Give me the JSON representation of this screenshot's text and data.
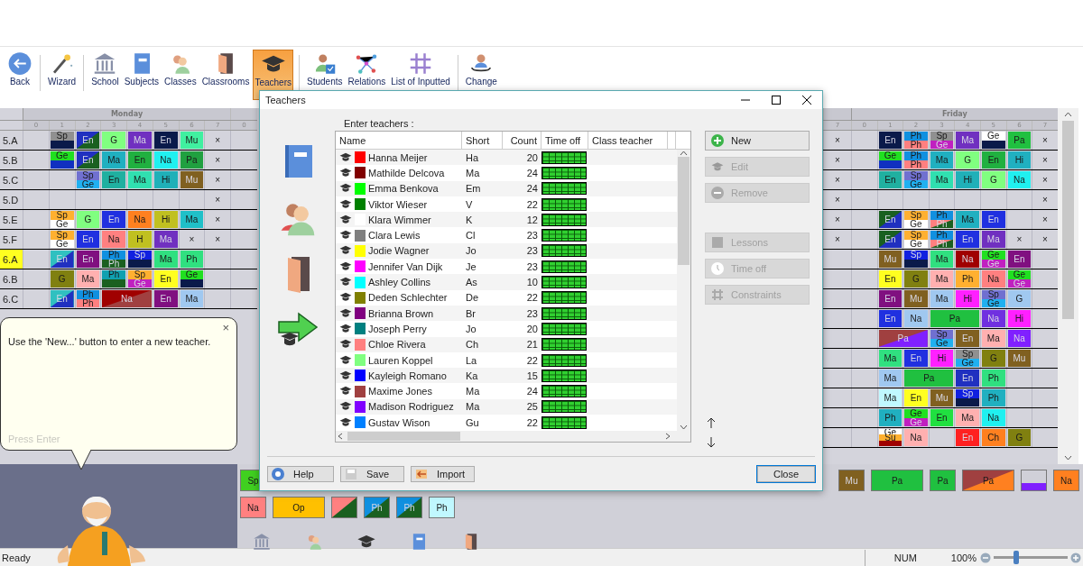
{
  "toolbar": [
    {
      "label": "Back",
      "selected": false,
      "divider_after": true
    },
    {
      "label": "Wizard",
      "selected": false,
      "divider_after": true
    },
    {
      "label": "School",
      "selected": false,
      "divider_after": false
    },
    {
      "label": "Subjects",
      "selected": false,
      "divider_after": false
    },
    {
      "label": "Classes",
      "selected": false,
      "divider_after": false
    },
    {
      "label": "Classrooms",
      "selected": false,
      "divider_after": false
    },
    {
      "label": "Teachers",
      "selected": true,
      "divider_after": true
    },
    {
      "label": "Students",
      "selected": false,
      "divider_after": false
    },
    {
      "label": "Relations",
      "selected": false,
      "divider_after": false
    },
    {
      "label": "List of Inputted",
      "selected": false,
      "divider_after": true
    },
    {
      "label": "Change",
      "selected": false,
      "divider_after": false
    }
  ],
  "timetable_left": {
    "day": "Monday",
    "periods": [
      "0",
      "1",
      "2",
      "3",
      "4",
      "5",
      "6",
      "7"
    ],
    "next_day_periods": [
      "0"
    ],
    "rows": [
      {
        "label": "5.A",
        "highlighted": false,
        "cells": [
          {},
          {
            "parts": [
              {
                "text": "Sp",
                "color": "#909090"
              },
              {
                "color": "#0a1a4a"
              }
            ]
          },
          {
            "parts": [
              {
                "text": "En",
                "color": "#2030c0",
                "corner": {
                  "color": "#1a6020"
                }
              }
            ]
          },
          {
            "parts": [
              {
                "text": "G",
                "color": "#80ff80"
              }
            ]
          },
          {
            "parts": [
              {
                "text": "Ma",
                "color": "#7030c0"
              }
            ]
          },
          {
            "parts": [
              {
                "text": "En",
                "color": "#0a1a4a"
              }
            ]
          },
          {
            "parts": [
              {
                "text": "Mu",
                "color": "#40f0a0"
              }
            ]
          },
          {
            "parts": [
              {
                "text": "×"
              }
            ]
          }
        ]
      },
      {
        "label": "5.B",
        "highlighted": false,
        "cells": [
          {},
          {
            "parts": [
              {
                "text": "Ge",
                "color": "#20e020"
              },
              {
                "color": "#1030c0"
              }
            ]
          },
          {
            "parts": [
              {
                "text": "En",
                "color": "#2030c0",
                "corner": {
                  "color": "#1a6020"
                }
              }
            ]
          },
          {
            "parts": [
              {
                "text": "Ma",
                "color": "#20b0c0"
              }
            ]
          },
          {
            "parts": [
              {
                "text": "En",
                "color": "#20b040"
              }
            ]
          },
          {
            "parts": [
              {
                "text": "Na",
                "color": "#20f0f0"
              }
            ]
          },
          {
            "parts": [
              {
                "text": "Pa",
                "color": "#20a040"
              }
            ]
          },
          {
            "parts": [
              {
                "text": "×"
              }
            ]
          }
        ]
      },
      {
        "label": "5.C",
        "highlighted": false,
        "cells": [
          {},
          {},
          {
            "parts": [
              {
                "text": "Sp",
                "color": "#7070d0"
              },
              {
                "text": "Ge",
                "color": "#20b0f0"
              }
            ]
          },
          {
            "parts": [
              {
                "text": "En",
                "color": "#20b0a0"
              }
            ]
          },
          {
            "parts": [
              {
                "text": "Ma",
                "color": "#30e0b0"
              }
            ]
          },
          {
            "parts": [
              {
                "text": "Hi",
                "color": "#20b0b8"
              }
            ]
          },
          {
            "parts": [
              {
                "text": "Mu",
                "color": "#806020"
              }
            ]
          },
          {
            "parts": [
              {
                "text": "×"
              }
            ]
          }
        ]
      },
      {
        "label": "5.D",
        "highlighted": false,
        "cells": [
          {},
          {},
          {},
          {},
          {},
          {},
          {},
          {
            "parts": [
              {
                "text": "×"
              }
            ]
          }
        ]
      },
      {
        "label": "5.E",
        "highlighted": false,
        "cells": [
          {},
          {
            "parts": [
              {
                "text": "Sp",
                "color": "#ffb030"
              },
              {
                "text": "Ge",
                "color": "#ffffff"
              }
            ]
          },
          {
            "parts": [
              {
                "text": "G",
                "color": "#80ff80"
              }
            ]
          },
          {
            "parts": [
              {
                "text": "En",
                "color": "#2030e0"
              }
            ]
          },
          {
            "parts": [
              {
                "text": "Na",
                "color": "#ff8020"
              }
            ]
          },
          {
            "parts": [
              {
                "text": "Hi",
                "color": "#c0c020"
              }
            ]
          },
          {
            "parts": [
              {
                "text": "Ma",
                "color": "#20c0c8"
              }
            ]
          },
          {
            "parts": [
              {
                "text": "×"
              }
            ]
          }
        ]
      },
      {
        "label": "5.F",
        "highlighted": false,
        "cells": [
          {},
          {
            "parts": [
              {
                "text": "Sp",
                "color": "#ffb030"
              },
              {
                "text": "Ge",
                "color": "#ffffff"
              }
            ]
          },
          {
            "parts": [
              {
                "text": "En",
                "color": "#2030e0"
              }
            ]
          },
          {
            "parts": [
              {
                "text": "Na",
                "color": "#ff8080"
              }
            ]
          },
          {
            "parts": [
              {
                "text": "H",
                "color": "#c0c020"
              }
            ]
          },
          {
            "parts": [
              {
                "text": "Ma",
                "color": "#7030c0"
              }
            ]
          },
          {
            "parts": [
              {
                "text": "×"
              }
            ]
          },
          {
            "parts": [
              {
                "text": "×"
              }
            ]
          }
        ]
      },
      {
        "label": "6.A",
        "highlighted": true,
        "cells": [
          {},
          {
            "parts": [
              {
                "text": "En",
                "color": "#30c0c0",
                "corner": {
                  "color": "#2030c0"
                }
              }
            ]
          },
          {
            "parts": [
              {
                "text": "En",
                "color": "#801080"
              }
            ]
          },
          {
            "parts": [
              {
                "text": "Ph",
                "color": "#1090e0"
              },
              {
                "text": "Ph",
                "color": "#1a6020"
              }
            ]
          },
          {
            "parts": [
              {
                "text": "Sp",
                "color": "#1020e0"
              },
              {
                "color": "#0a1a4a"
              }
            ]
          },
          {
            "parts": [
              {
                "text": "Ma",
                "color": "#30e080"
              }
            ]
          },
          {
            "parts": [
              {
                "text": "Ph",
                "color": "#30e080"
              }
            ]
          },
          {}
        ]
      },
      {
        "label": "6.B",
        "highlighted": false,
        "cells": [
          {},
          {
            "parts": [
              {
                "text": "G",
                "color": "#808010"
              }
            ]
          },
          {
            "parts": [
              {
                "text": "Ma",
                "color": "#ffb0b0"
              }
            ]
          },
          {
            "parts": [
              {
                "text": "Ph",
                "color": "#10a0b0"
              },
              {
                "color": "#1a6020"
              }
            ]
          },
          {
            "parts": [
              {
                "text": "Sp",
                "color": "#ffb030"
              },
              {
                "text": "Ge",
                "color": "#c020c0"
              }
            ]
          },
          {
            "parts": [
              {
                "text": "En",
                "color": "#ffff20"
              }
            ]
          },
          {
            "parts": [
              {
                "text": "Ge",
                "color": "#20e020"
              },
              {
                "color": "#0a1a4a"
              }
            ]
          },
          {}
        ]
      },
      {
        "label": "6.C",
        "highlighted": false,
        "cells": [
          {},
          {
            "parts": [
              {
                "text": "En",
                "color": "#30c0c0",
                "corner": {
                  "color": "#2030c0"
                }
              }
            ]
          },
          {
            "parts": [
              {
                "text": "Ph",
                "color": "#1090e0"
              },
              {
                "text": "Ph",
                "color": "#ff8080"
              }
            ]
          },
          {
            "parts": [
              {
                "text": "Na",
                "color": "#a00000",
                "corner": {
                  "color": "#a04040"
                }
              }
            ]
          },
          {
            "merged": true
          },
          {
            "parts": [
              {
                "text": "En",
                "color": "#801080"
              }
            ]
          },
          {
            "parts": [
              {
                "text": "Ma",
                "color": "#a0c8f0"
              }
            ]
          },
          {}
        ]
      }
    ]
  },
  "timetable_right": {
    "day": "Friday",
    "prev_periods": [
      "7"
    ],
    "periods": [
      "0",
      "1",
      "2",
      "3",
      "4",
      "5",
      "6",
      "7"
    ],
    "rows": [
      {
        "prev": {
          "parts": [
            {
              "text": "×"
            }
          ]
        },
        "cells": [
          {},
          {
            "parts": [
              {
                "text": "En",
                "color": "#0a1a4a"
              }
            ]
          },
          {
            "parts": [
              {
                "text": "Ph",
                "color": "#1090e0"
              },
              {
                "text": "Ph",
                "color": "#ff8080"
              }
            ]
          },
          {
            "parts": [
              {
                "text": "Sp",
                "color": "#909090"
              },
              {
                "text": "Ge",
                "color": "#c020c0"
              }
            ]
          },
          {
            "parts": [
              {
                "text": "Ma",
                "color": "#7030c0"
              }
            ]
          },
          {
            "parts": [
              {
                "text": "Ge",
                "color": "#ffffff"
              },
              {
                "color": "#0a1a4a"
              }
            ]
          },
          {
            "parts": [
              {
                "text": "Pa",
                "color": "#20c040"
              }
            ]
          },
          {
            "parts": [
              {
                "text": "×"
              }
            ]
          }
        ]
      },
      {
        "prev": {
          "parts": [
            {
              "text": "×"
            }
          ]
        },
        "cells": [
          {},
          {
            "parts": [
              {
                "text": "Ge",
                "color": "#20e020"
              },
              {
                "color": "#1030c0"
              }
            ]
          },
          {
            "parts": [
              {
                "text": "Ph",
                "color": "#1090e0"
              },
              {
                "text": "Ph",
                "color": "#ff8080"
              }
            ]
          },
          {
            "parts": [
              {
                "text": "Ma",
                "color": "#20b0c0"
              }
            ]
          },
          {
            "parts": [
              {
                "text": "G",
                "color": "#80ff80"
              }
            ]
          },
          {
            "parts": [
              {
                "text": "En",
                "color": "#20b040"
              }
            ]
          },
          {
            "parts": [
              {
                "text": "Hi",
                "color": "#20b0c0"
              }
            ]
          },
          {
            "parts": [
              {
                "text": "×"
              }
            ]
          }
        ]
      },
      {
        "prev": {
          "parts": [
            {
              "text": "×"
            }
          ]
        },
        "cells": [
          {},
          {
            "parts": [
              {
                "text": "En",
                "color": "#20b0a0"
              }
            ]
          },
          {
            "parts": [
              {
                "text": "Sp",
                "color": "#7070d0"
              },
              {
                "text": "Ge",
                "color": "#20b0f0"
              }
            ]
          },
          {
            "parts": [
              {
                "text": "Ma",
                "color": "#30e0b0"
              }
            ]
          },
          {
            "parts": [
              {
                "text": "Hi",
                "color": "#20b0b8"
              }
            ]
          },
          {
            "parts": [
              {
                "text": "G",
                "color": "#80ff80"
              }
            ]
          },
          {
            "parts": [
              {
                "text": "Na",
                "color": "#20f0f0"
              }
            ]
          },
          {
            "parts": [
              {
                "text": "×"
              }
            ]
          }
        ]
      },
      {
        "prev": {
          "parts": [
            {
              "text": "×"
            }
          ]
        },
        "cells": [
          {},
          {},
          {},
          {},
          {},
          {},
          {},
          {
            "parts": [
              {
                "text": "×"
              }
            ]
          }
        ]
      },
      {
        "prev": {
          "parts": [
            {
              "text": "×"
            }
          ]
        },
        "cells": [
          {},
          {
            "parts": [
              {
                "text": "En",
                "color": "#1a6020",
                "corner": {
                  "color": "#2030c0"
                }
              }
            ]
          },
          {
            "parts": [
              {
                "text": "Sp",
                "color": "#ffb030"
              },
              {
                "text": "Ge",
                "color": "#ffffff"
              }
            ]
          },
          {
            "parts": [
              {
                "text": "Ph",
                "color": "#1090e0"
              },
              {
                "text": "Ph",
                "color": "#ff8080",
                "corner": {
                  "color": "#1a6020"
                }
              }
            ]
          },
          {
            "parts": [
              {
                "text": "Ma",
                "color": "#20b0c0"
              }
            ]
          },
          {
            "parts": [
              {
                "text": "En",
                "color": "#2030e0"
              }
            ]
          },
          {},
          {
            "parts": [
              {
                "text": "×"
              }
            ]
          }
        ]
      },
      {
        "prev": {
          "parts": [
            {
              "text": "×"
            }
          ]
        },
        "cells": [
          {},
          {
            "parts": [
              {
                "text": "En",
                "color": "#1a6020",
                "corner": {
                  "color": "#2030c0"
                }
              }
            ]
          },
          {
            "parts": [
              {
                "text": "Sp",
                "color": "#ffb030"
              },
              {
                "text": "Ge",
                "color": "#ffffff"
              }
            ]
          },
          {
            "parts": [
              {
                "text": "Ph",
                "color": "#1090e0"
              },
              {
                "text": "Ph",
                "color": "#ff8080",
                "corner": {
                  "color": "#1a6020"
                }
              }
            ]
          },
          {
            "parts": [
              {
                "text": "En",
                "color": "#2030e0"
              }
            ]
          },
          {
            "parts": [
              {
                "text": "Ma",
                "color": "#7030c0"
              }
            ]
          },
          {
            "parts": [
              {
                "text": "×"
              }
            ]
          },
          {
            "parts": [
              {
                "text": "×"
              }
            ]
          }
        ]
      },
      {
        "prev": {},
        "cells": [
          {},
          {
            "parts": [
              {
                "text": "Mu",
                "color": "#806020"
              }
            ]
          },
          {
            "parts": [
              {
                "text": "Sp",
                "color": "#1020e0"
              },
              {
                "color": "#0a1a4a"
              }
            ]
          },
          {
            "parts": [
              {
                "text": "Ma",
                "color": "#30e080"
              }
            ]
          },
          {
            "parts": [
              {
                "text": "Na",
                "color": "#a00000"
              }
            ]
          },
          {
            "parts": [
              {
                "text": "Ge",
                "color": "#20e020"
              },
              {
                "text": "Ge",
                "color": "#c020c0"
              }
            ]
          },
          {
            "parts": [
              {
                "text": "En",
                "color": "#801080"
              }
            ]
          },
          {}
        ]
      },
      {
        "prev": {},
        "cells": [
          {},
          {
            "parts": [
              {
                "text": "En",
                "color": "#ffff20"
              }
            ]
          },
          {
            "parts": [
              {
                "text": "G",
                "color": "#808010"
              }
            ]
          },
          {
            "parts": [
              {
                "text": "Ma",
                "color": "#ffb0b0"
              }
            ]
          },
          {
            "parts": [
              {
                "text": "Ph",
                "color": "#ffb030"
              }
            ]
          },
          {
            "parts": [
              {
                "text": "Na",
                "color": "#ff8080"
              }
            ]
          },
          {
            "parts": [
              {
                "text": "Ge",
                "color": "#20e020"
              },
              {
                "text": "Ge",
                "color": "#c020c0"
              }
            ]
          },
          {}
        ]
      },
      {
        "prev": {},
        "cells": [
          {},
          {
            "parts": [
              {
                "text": "En",
                "color": "#801080"
              }
            ]
          },
          {
            "parts": [
              {
                "text": "Mu",
                "color": "#806020"
              }
            ]
          },
          {
            "parts": [
              {
                "text": "Ma",
                "color": "#a0c8f0"
              }
            ]
          },
          {
            "parts": [
              {
                "text": "Hi",
                "color": "#ff20ff"
              }
            ]
          },
          {
            "parts": [
              {
                "text": "Sp",
                "color": "#7070d0"
              },
              {
                "text": "Ge",
                "color": "#20b0f0"
              }
            ]
          },
          {
            "parts": [
              {
                "text": "G",
                "color": "#a0c8f0"
              }
            ]
          },
          {}
        ]
      },
      {
        "prev": {},
        "cells": [
          {},
          {
            "parts": [
              {
                "text": "En",
                "color": "#2030e0"
              }
            ]
          },
          {
            "parts": [
              {
                "text": "Na",
                "color": "#a0c8f0"
              }
            ]
          },
          {
            "parts": [
              {
                "text": "Pa",
                "color": "#20c040"
              }
            ]
          },
          {
            "merged": true
          },
          {
            "parts": [
              {
                "text": "Na",
                "color": "#7030e0"
              }
            ]
          },
          {
            "parts": [
              {
                "text": "Hi",
                "color": "#ff20ff"
              }
            ]
          },
          {}
        ]
      },
      {
        "prev": {},
        "cells": [
          {},
          {
            "parts": [
              {
                "text": "Pa",
                "color": "#a04040",
                "corner": {
                  "color": "#8020ff"
                }
              }
            ]
          },
          {
            "merged": true
          },
          {
            "parts": [
              {
                "text": "Sp",
                "color": "#7070d0"
              },
              {
                "text": "Ge",
                "color": "#20b0f0"
              }
            ]
          },
          {
            "parts": [
              {
                "text": "En",
                "color": "#806020"
              }
            ]
          },
          {
            "parts": [
              {
                "text": "Ma",
                "color": "#ffb0b0"
              }
            ]
          },
          {
            "parts": [
              {
                "text": "Na",
                "color": "#8020ff"
              }
            ]
          },
          {}
        ]
      },
      {
        "prev": {},
        "cells": [
          {},
          {
            "parts": [
              {
                "text": "Ma",
                "color": "#30e080"
              }
            ]
          },
          {
            "parts": [
              {
                "text": "En",
                "color": "#2030e0"
              }
            ]
          },
          {
            "parts": [
              {
                "text": "Hi",
                "color": "#ff20ff"
              }
            ]
          },
          {
            "parts": [
              {
                "text": "Sp",
                "color": "#909090"
              },
              {
                "text": "Ge",
                "color": "#20b0f0"
              }
            ]
          },
          {
            "parts": [
              {
                "text": "G",
                "color": "#808010"
              }
            ]
          },
          {
            "parts": [
              {
                "text": "Mu",
                "color": "#806020"
              }
            ]
          },
          {}
        ]
      },
      {
        "prev": {},
        "cells": [
          {},
          {
            "parts": [
              {
                "text": "Ma",
                "color": "#a0c8f0"
              }
            ]
          },
          {
            "parts": [
              {
                "text": "Pa",
                "color": "#20c040"
              }
            ]
          },
          {
            "merged": true
          },
          {
            "parts": [
              {
                "text": "En",
                "color": "#2030c0"
              }
            ]
          },
          {
            "parts": [
              {
                "text": "Ph",
                "color": "#30e080"
              }
            ]
          },
          {},
          {}
        ]
      },
      {
        "prev": {},
        "cells": [
          {},
          {
            "parts": [
              {
                "text": "Ma",
                "color": "#c0f8ff"
              }
            ]
          },
          {
            "parts": [
              {
                "text": "En",
                "color": "#ffff20"
              }
            ]
          },
          {
            "parts": [
              {
                "text": "Mu",
                "color": "#806020"
              }
            ]
          },
          {
            "parts": [
              {
                "text": "Sp",
                "color": "#1020e0"
              },
              {
                "color": "#0a1a4a"
              }
            ]
          },
          {
            "parts": [
              {
                "text": "Ph",
                "color": "#20b0c0"
              }
            ]
          },
          {},
          {}
        ]
      },
      {
        "prev": {},
        "cells": [
          {},
          {
            "parts": [
              {
                "text": "Ph",
                "color": "#20b0c0"
              }
            ]
          },
          {
            "parts": [
              {
                "text": "Ge",
                "color": "#20e020"
              },
              {
                "text": "Ge",
                "color": "#c020c0"
              }
            ]
          },
          {
            "parts": [
              {
                "text": "En",
                "color": "#20e040"
              }
            ]
          },
          {
            "parts": [
              {
                "text": "Ma",
                "color": "#ffb0b0"
              }
            ]
          },
          {
            "parts": [
              {
                "text": "Na",
                "color": "#20f0f0"
              }
            ]
          },
          {},
          {}
        ]
      },
      {
        "prev": {},
        "cells": [
          {},
          {
            "parts": [
              {
                "text": "Ge",
                "color": "#ffffff"
              },
              {
                "text": "Su",
                "color": "#ffb030"
              },
              {
                "color": "#a00000"
              }
            ]
          },
          {
            "parts": [
              {
                "text": "Na",
                "color": "#ffb0b0"
              }
            ]
          },
          {},
          {
            "parts": [
              {
                "text": "En",
                "color": "#ff2020"
              }
            ]
          },
          {
            "parts": [
              {
                "text": "Ch",
                "color": "#ff8020"
              }
            ]
          },
          {
            "parts": [
              {
                "text": "G",
                "color": "#808010"
              }
            ]
          },
          {}
        ]
      }
    ]
  },
  "tray": {
    "row1_left": [
      {
        "text": "Sp",
        "color": "#40d020"
      }
    ],
    "row1_right": [
      {
        "text": "Mu",
        "color": "#806020"
      },
      {
        "text": "Pa",
        "color": "#20c040",
        "kind": "double"
      },
      {
        "text": "Pa",
        "color": "#20c040"
      },
      {
        "text": "Pa",
        "color": "#a04040",
        "corner": {
          "color": "#ff8020"
        },
        "kind": "double"
      },
      {
        "color": "#d0d0d8",
        "band": {
          "color": "#8020ff"
        }
      },
      {
        "text": "Na",
        "color": "#ff8020"
      }
    ],
    "row2": [
      {
        "text": "Na",
        "color": "#ff8080"
      },
      {
        "text": "Op",
        "color": "#ffc000",
        "kind": "double"
      },
      {
        "color": "#ff8080",
        "corner": {
          "color": "#1a6020"
        }
      },
      {
        "text": "Ph",
        "color": "#1090e0",
        "corner": {
          "color": "#1a6020"
        }
      },
      {
        "text": "Ph",
        "color": "#1090e0",
        "corner": {
          "color": "#1a6020"
        }
      },
      {
        "text": "Ph",
        "color": "#c0f8ff"
      }
    ]
  },
  "dialog": {
    "title": "Teachers",
    "prompt": "Enter teachers :",
    "columns": [
      "Name",
      "Short",
      "Count",
      "Time off",
      "Class teacher"
    ],
    "teachers": [
      {
        "name": "Hanna Meijer",
        "short": "Ha",
        "count": "20",
        "color": "#ff0000"
      },
      {
        "name": "Mathilde Delcova",
        "short": "Ma",
        "count": "24",
        "color": "#800000"
      },
      {
        "name": "Emma Benkova",
        "short": "Em",
        "count": "24",
        "color": "#00ff00"
      },
      {
        "name": "Viktor Wieser",
        "short": "V",
        "count": "22",
        "color": "#008000"
      },
      {
        "name": "Klara Wimmer",
        "short": "K",
        "count": "12",
        "color": "#ffffff"
      },
      {
        "name": "Clara Lewis",
        "short": "Cl",
        "count": "23",
        "color": "#808080"
      },
      {
        "name": "Jodie Wagner",
        "short": "Jo",
        "count": "23",
        "color": "#ffff00"
      },
      {
        "name": "Jennifer Van Dijk",
        "short": "Je",
        "count": "23",
        "color": "#ff00ff"
      },
      {
        "name": "Ashley Collins",
        "short": "As",
        "count": "10",
        "color": "#00ffff"
      },
      {
        "name": "Deden Schlechter",
        "short": "De",
        "count": "22",
        "color": "#808000"
      },
      {
        "name": "Brianna Brown",
        "short": "Br",
        "count": "23",
        "color": "#800080"
      },
      {
        "name": "Joseph Perry",
        "short": "Jo",
        "count": "20",
        "color": "#008080"
      },
      {
        "name": "Chloe Rivera",
        "short": "Ch",
        "count": "21",
        "color": "#ff8080"
      },
      {
        "name": "Lauren Koppel",
        "short": "La",
        "count": "22",
        "color": "#80ff80"
      },
      {
        "name": "Kayleigh Romano",
        "short": "Ka",
        "count": "15",
        "color": "#0000ff"
      },
      {
        "name": "Maxime Jones",
        "short": "Ma",
        "count": "24",
        "color": "#a04040"
      },
      {
        "name": "Madison Rodriguez",
        "short": "Ma",
        "count": "25",
        "color": "#8000ff"
      },
      {
        "name": "Gustav Wison",
        "short": "Gu",
        "count": "22",
        "color": "#0080ff"
      }
    ],
    "side_buttons": [
      {
        "label": "New",
        "disabled": false
      },
      {
        "label": "Edit",
        "disabled": true
      },
      {
        "label": "Remove",
        "disabled": true
      },
      {
        "label": "Lessons",
        "disabled": true
      },
      {
        "label": "Time off",
        "disabled": true
      },
      {
        "label": "Constraints",
        "disabled": true
      }
    ],
    "footer_buttons": [
      {
        "label": "Help"
      },
      {
        "label": "Save"
      },
      {
        "label": "Import"
      }
    ],
    "close_button": "Close"
  },
  "help_bubble": {
    "text": "Use the 'New...' button to enter a new teacher.",
    "close": "×",
    "hint": "Press Enter"
  },
  "status_bar": {
    "text": "Ready",
    "num": "NUM",
    "zoom": "100%",
    "zoom_slider": {
      "level": 0.3
    }
  }
}
